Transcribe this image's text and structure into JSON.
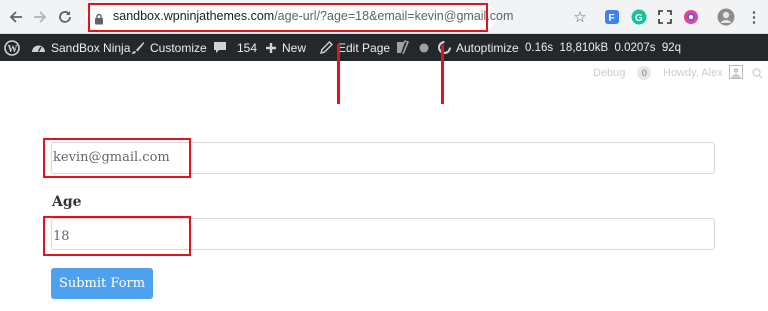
{
  "browser": {
    "url_host": "sandbox.wpninjathemes.com",
    "url_path": "/age-url/?age=18&email=kevin@gmail.com",
    "highlight_color": "#e3121c",
    "toolbar_bg": "#f1f3f4"
  },
  "admin_bar": {
    "bg": "#23282d",
    "site_name": "SandBox Ninja",
    "customize": "Customize",
    "comments_count": "154",
    "new_label": "New",
    "edit_page": "Edit Page",
    "autoptimize": "Autoptimize",
    "perf_time": "0.16s",
    "perf_memory": "18,810kB",
    "perf_query_time": "0.0207s",
    "perf_queries": "92q"
  },
  "sub_bar": {
    "debug_label": "Debug",
    "debug_count": "0",
    "howdy": "Howdy, Alex"
  },
  "form": {
    "email_value": "kevin@gmail.com",
    "age_label": "Age",
    "age_value": "18",
    "submit_label": "Submit Form",
    "submit_color": "#4da1ee"
  }
}
